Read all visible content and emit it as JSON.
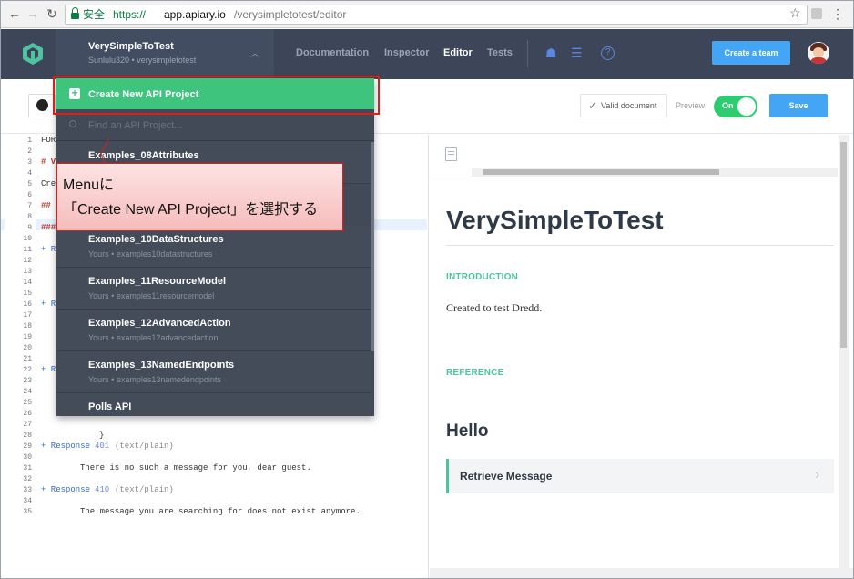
{
  "browser": {
    "secure_label": "安全",
    "url_scheme": "https://",
    "url_host": "app.apiary.io",
    "url_path": "/verysimpletotest/editor"
  },
  "header": {
    "project_title": "VerySimpleToTest",
    "project_subtitle": "Sunlulu320 • verysimpletotest",
    "tabs": [
      {
        "label": "Documentation",
        "active": false
      },
      {
        "label": "Inspector",
        "active": false
      },
      {
        "label": "Editor",
        "active": true
      },
      {
        "label": "Tests",
        "active": false
      }
    ],
    "create_team_label": "Create a team"
  },
  "toolbar": {
    "valid_document_label": "Valid document",
    "preview_label": "Preview",
    "toggle_label": "On",
    "save_label": "Save"
  },
  "editor": {
    "line_numbers": [
      "1",
      "2",
      "3",
      "4",
      "5",
      "6",
      "7",
      "8",
      "9",
      "10",
      "11",
      "12",
      "13",
      "14",
      "15",
      "16",
      "17",
      "18",
      "19",
      "20",
      "21",
      "22",
      "23",
      "24",
      "25",
      "26",
      "27",
      "28",
      "29",
      "30",
      "31",
      "32",
      "33",
      "34",
      "35"
    ],
    "fragments": {
      "l1": "FOR",
      "l3": "# V",
      "l5": "Cre",
      "l7": "## ",
      "l9": "###",
      "l11": "+ R",
      "l16": "+ R",
      "l22": "+ R",
      "l28": "}",
      "l29_a": "+ Response",
      "l29_b": "401",
      "l29_c": "(text/plain)",
      "l31": "There is no such a message for you, dear guest.",
      "l33_a": "+ Response",
      "l33_b": "410",
      "l33_c": "(text/plain)",
      "l35": "The message you are searching for does not exist anymore."
    }
  },
  "preview": {
    "title": "VerySimpleToTest",
    "intro_heading": "INTRODUCTION",
    "intro_text": "Created to test Dredd.",
    "reference_heading": "REFERENCE",
    "group_title": "Hello",
    "action_label": "Retrieve Message"
  },
  "dropdown": {
    "create_label": "Create New API Project",
    "search_placeholder": "Find an API Project...",
    "items": [
      {
        "title": "Examples_08Attributes",
        "subtitle": ""
      },
      {
        "title": "Examples_10DataStructures",
        "subtitle": "Yours • examples10datastructures"
      },
      {
        "title": "Examples_11ResourceModel",
        "subtitle": "Yours • examples11resourcemodel"
      },
      {
        "title": "Examples_12AdvancedAction",
        "subtitle": "Yours • examples12advancedaction"
      },
      {
        "title": "Examples_13NamedEndpoints",
        "subtitle": "Yours • examples13namedendpoints"
      },
      {
        "title": "Polls API",
        "subtitle": ""
      }
    ]
  },
  "annotation": {
    "line1": "Menuに",
    "line2": "「Create  New  API  Project」を選択する"
  },
  "colors": {
    "header_bg": "#3c4658",
    "accent_green": "#3fc47e",
    "accent_blue": "#45a5f5",
    "annotation_red": "#d9201a"
  }
}
